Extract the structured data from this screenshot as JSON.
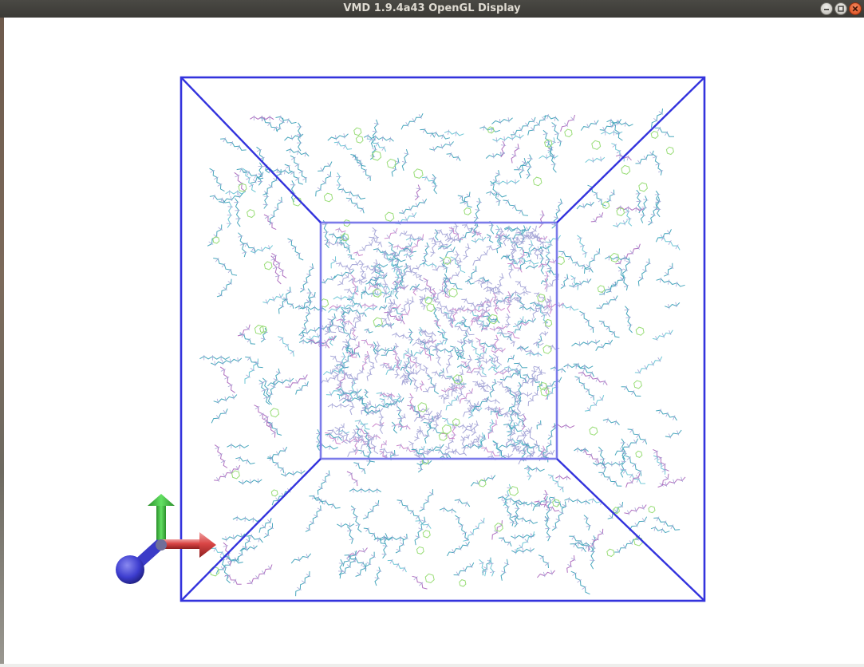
{
  "window": {
    "title": "VMD 1.9.4a43 OpenGL Display"
  },
  "controls": {
    "minimize_icon": "minimize-icon",
    "maximize_icon": "maximize-icon",
    "close_icon": "close-icon"
  },
  "scene": {
    "representation": "Lines",
    "cell_color": "#3333dd",
    "inner_cell_color": "#7b7bea",
    "molecule_colors": [
      "#49a7bd",
      "#6fc7d6",
      "#a8a8d8",
      "#b070c0",
      "#99dd77",
      "#cc88cc"
    ],
    "axes": {
      "x_color": "#d94545",
      "y_color": "#3fc13f",
      "z_color": "#3d3dcf"
    }
  }
}
